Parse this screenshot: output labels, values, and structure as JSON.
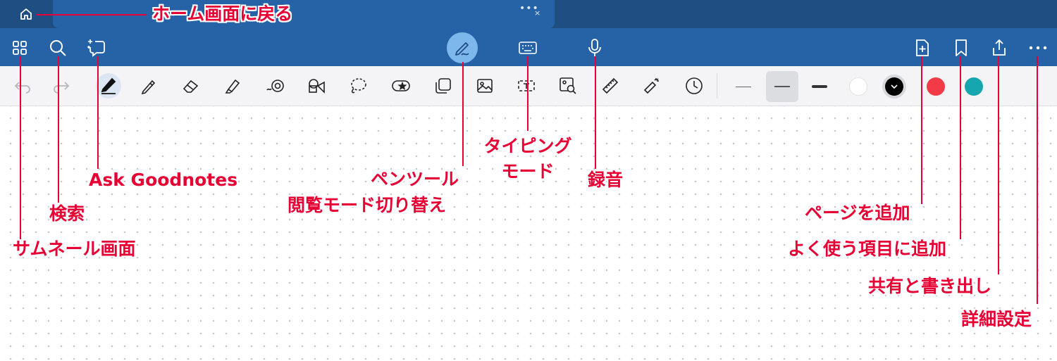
{
  "annotations": {
    "home": "ホーム画面に戻る",
    "thumbnail": "サムネール画面",
    "search": "検索",
    "ask": "Ask Goodnotes",
    "pen_line1": "ペンツール",
    "pen_line2": "閲覧モード切り替え",
    "typing_line1": "タイピング",
    "typing_line2": "モード",
    "record": "録音",
    "add_page": "ページを追加",
    "favorite": "よく使う項目に追加",
    "share": "共有と書き出し",
    "settings": "詳細設定"
  },
  "tab": {
    "menu_dots": "•••",
    "close": "×"
  },
  "toolbar": {
    "tools": [
      "undo-icon",
      "redo-icon",
      "pen-icon",
      "pencil-icon",
      "eraser-icon",
      "highlighter-icon",
      "shapes-icon",
      "elements-icon",
      "lasso-icon",
      "sticker-icon",
      "sticky-note-icon",
      "image-icon",
      "text-box-icon",
      "image-search-icon",
      "ruler-icon",
      "laser-pointer-icon",
      "recent-icon"
    ],
    "selected_tool": "pen-icon",
    "widths": [
      "thin",
      "medium",
      "thick"
    ],
    "selected_width": "medium",
    "colors": [
      "#ffffff",
      "#000000",
      "#f23b47",
      "#16a6b0"
    ],
    "selected_color": "#000000"
  },
  "colors": {
    "titlebar": "#1f4e82",
    "appbar": "#2563a6",
    "annotation": "#e60033",
    "pen_mode_active": "#7db7ec"
  }
}
